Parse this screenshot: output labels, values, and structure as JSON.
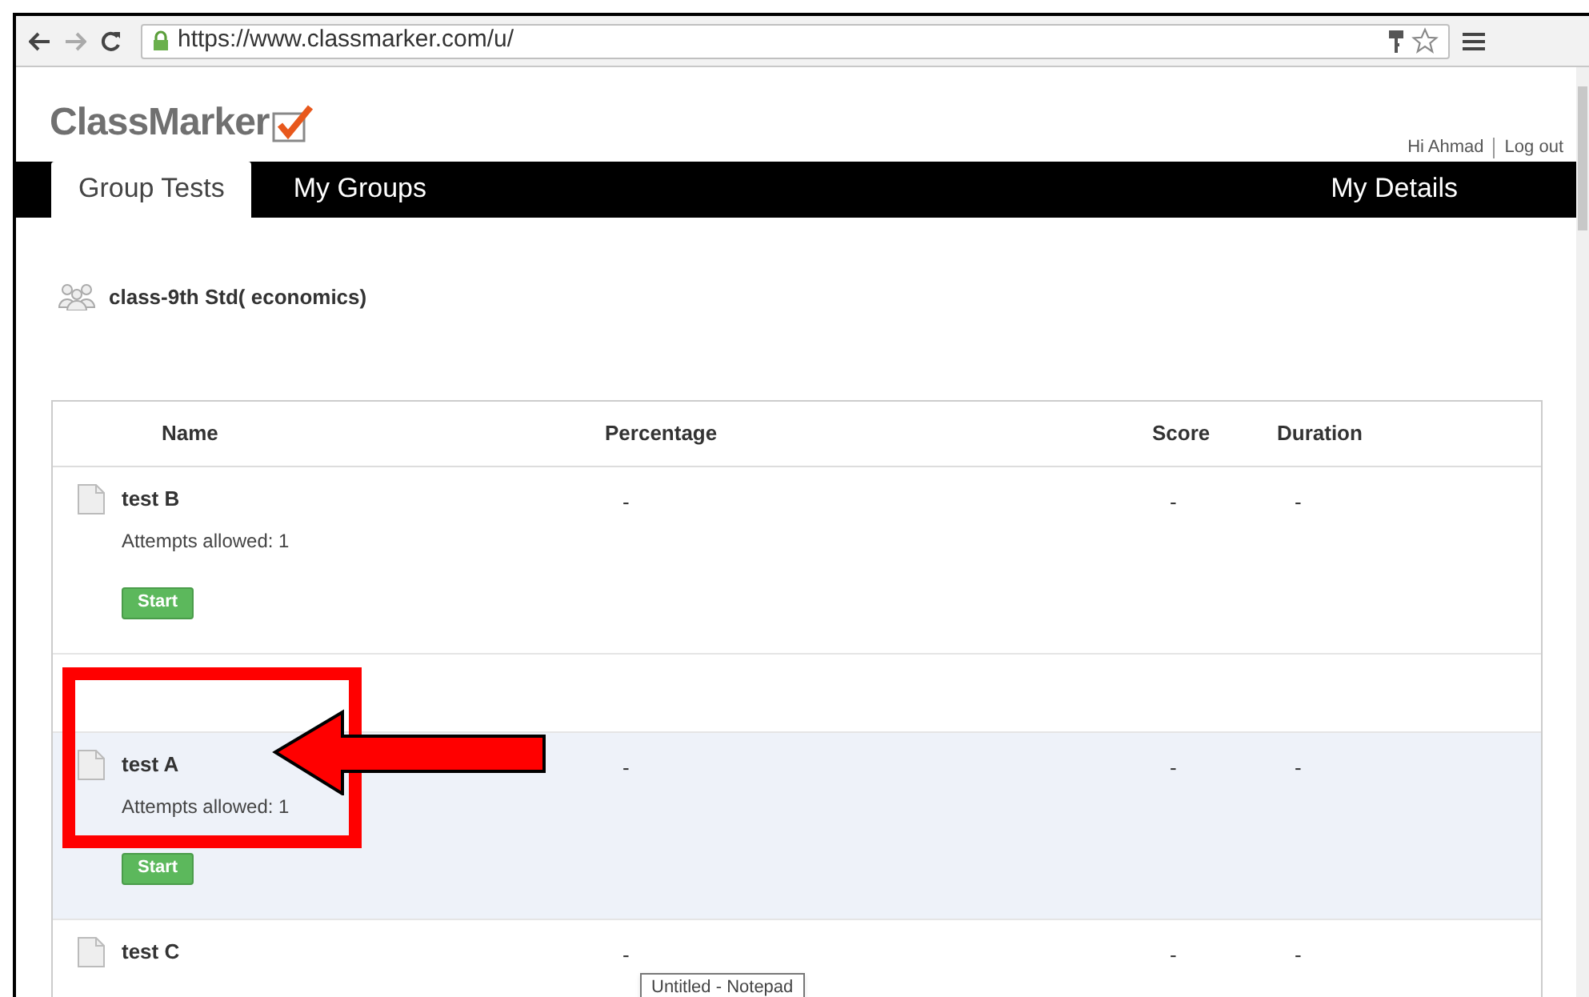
{
  "browser": {
    "url": "https://www.classmarker.com/u/"
  },
  "header": {
    "logo": "ClassMarker",
    "greeting": "Hi Ahmad",
    "logout": "Log out"
  },
  "nav": {
    "tabs": [
      {
        "label": "Group Tests",
        "selected": true
      },
      {
        "label": "My Groups",
        "selected": false
      }
    ],
    "right_link": "My Details"
  },
  "group": {
    "name": "class-9th Std( economics)"
  },
  "table": {
    "columns": [
      "Name",
      "Percentage",
      "Score",
      "Duration"
    ],
    "rows": [
      {
        "kind": "test",
        "name": "test B",
        "attempts": "Attempts allowed: 1",
        "button": "Start",
        "percentage": "-",
        "score": "-",
        "duration": "-",
        "highlighted": false
      },
      {
        "kind": "spacer",
        "highlighted": false
      },
      {
        "kind": "test",
        "name": "test A",
        "attempts": "Attempts allowed: 1",
        "button": "Start",
        "percentage": "-",
        "score": "-",
        "duration": "-",
        "highlighted": true
      },
      {
        "kind": "test",
        "name": "test C",
        "percentage": "-",
        "score": "-",
        "duration": "-",
        "highlighted": false
      }
    ]
  },
  "taskbar_tooltip": "Untitled - Notepad"
}
